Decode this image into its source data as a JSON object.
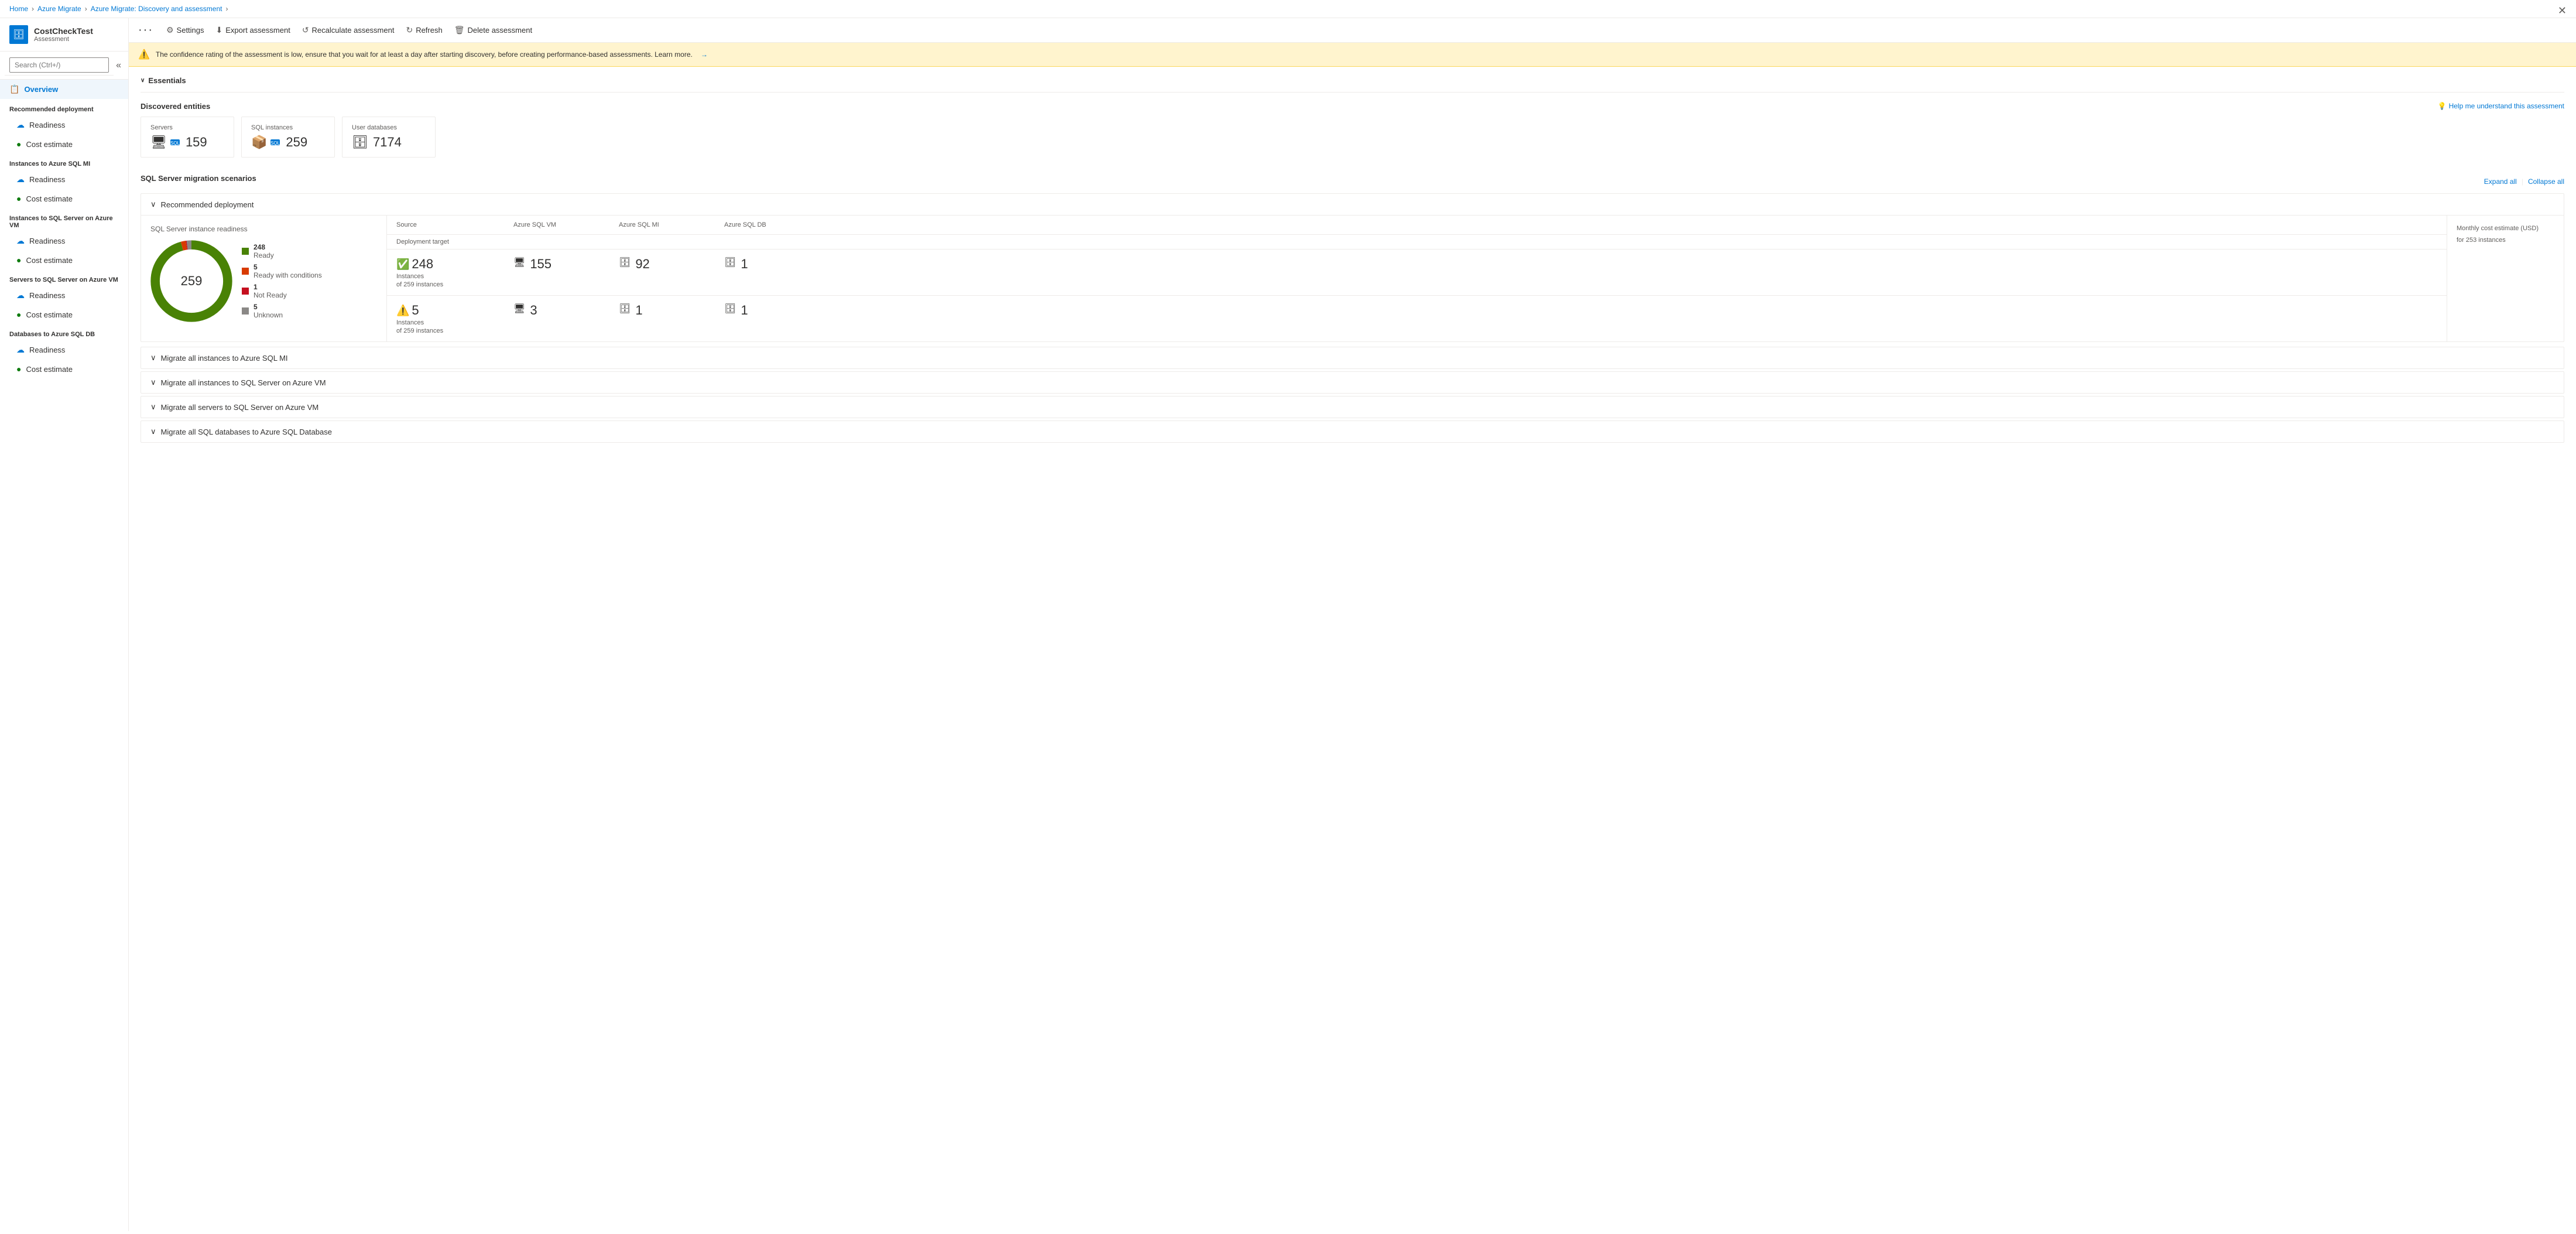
{
  "breadcrumb": {
    "items": [
      "Home",
      "Azure Migrate",
      "Azure Migrate: Discovery and assessment"
    ]
  },
  "sidebar": {
    "app_icon": "🗄",
    "app_title": "CostCheckTest",
    "app_subtitle": "Assessment",
    "search_placeholder": "Search (Ctrl+/)",
    "collapse_icon": "«",
    "nav": [
      {
        "id": "overview",
        "label": "Overview",
        "icon": "📋",
        "active": true
      },
      {
        "section": "Recommended deployment"
      },
      {
        "id": "rec-readiness",
        "label": "Readiness",
        "icon": "☁",
        "indent": true
      },
      {
        "id": "rec-cost",
        "label": "Cost estimate",
        "icon": "🟢",
        "indent": true
      },
      {
        "section": "Instances to Azure SQL MI"
      },
      {
        "id": "sqlmi-readiness",
        "label": "Readiness",
        "icon": "☁",
        "indent": true
      },
      {
        "id": "sqlmi-cost",
        "label": "Cost estimate",
        "icon": "🟢",
        "indent": true
      },
      {
        "section": "Instances to SQL Server on Azure VM"
      },
      {
        "id": "sqlvm-readiness",
        "label": "Readiness",
        "icon": "☁",
        "indent": true
      },
      {
        "id": "sqlvm-cost",
        "label": "Cost estimate",
        "icon": "🟢",
        "indent": true
      },
      {
        "section": "Servers to SQL Server on Azure VM"
      },
      {
        "id": "srvvm-readiness",
        "label": "Readiness",
        "icon": "☁",
        "indent": true
      },
      {
        "id": "srvvm-cost",
        "label": "Cost estimate",
        "icon": "🟢",
        "indent": true
      },
      {
        "section": "Databases to Azure SQL DB"
      },
      {
        "id": "sqldb-readiness",
        "label": "Readiness",
        "icon": "☁",
        "indent": true
      },
      {
        "id": "sqldb-cost",
        "label": "Cost estimate",
        "icon": "🟢",
        "indent": true
      }
    ]
  },
  "toolbar": {
    "dots": "...",
    "buttons": [
      {
        "id": "settings",
        "label": "Settings",
        "icon": "⚙"
      },
      {
        "id": "export",
        "label": "Export assessment",
        "icon": "⬇"
      },
      {
        "id": "recalculate",
        "label": "Recalculate assessment",
        "icon": "↺"
      },
      {
        "id": "refresh",
        "label": "Refresh",
        "icon": "↻"
      },
      {
        "id": "delete",
        "label": "Delete assessment",
        "icon": "🗑"
      }
    ]
  },
  "alert": {
    "icon": "⚠",
    "text": "The confidence rating of the assessment is low, ensure that you wait for at least a day after starting discovery, before creating performance-based assessments. Learn more.",
    "link_text": "→"
  },
  "essentials": {
    "label": "Essentials",
    "chevron": "∨"
  },
  "help_link": {
    "icon": "💡",
    "label": "Help me understand this assessment"
  },
  "discovered_entities": {
    "title": "Discovered entities",
    "cards": [
      {
        "label": "Servers",
        "value": "159",
        "icon": "🖥"
      },
      {
        "label": "SQL instances",
        "value": "259",
        "icon": "🗄"
      },
      {
        "label": "User databases",
        "value": "7174",
        "icon": "🗄"
      }
    ]
  },
  "migration_scenarios": {
    "title": "SQL Server migration scenarios",
    "expand_all": "Expand all",
    "collapse_all": "Collapse all",
    "recommended": {
      "label": "Recommended deployment",
      "chart": {
        "title": "SQL Server instance readiness",
        "total": "259",
        "legend": [
          {
            "color": "#498205",
            "label": "Ready",
            "value": "248"
          },
          {
            "color": "#d83b01",
            "label": "Ready with conditions",
            "value": "5"
          },
          {
            "color": "#c50f1f",
            "label": "Not Ready",
            "value": "1"
          },
          {
            "color": "#8a8886",
            "label": "Unknown",
            "value": "5"
          }
        ]
      },
      "data_header": {
        "source": "Source",
        "deployment_target": "Deployment target",
        "azure_sql_vm": "Azure SQL VM",
        "azure_sql_mi": "Azure SQL MI",
        "azure_sql_db": "Azure SQL DB"
      },
      "rows": [
        {
          "source_icon": "✅",
          "source_count": "248",
          "source_sub": "of 259 instances",
          "source_label": "Instances",
          "azure_sql_vm": "155",
          "azure_sql_mi": "92",
          "azure_sql_db": "1"
        },
        {
          "source_icon": "⚠",
          "source_count": "5",
          "source_sub": "of 259 instances",
          "source_label": "Instances",
          "azure_sql_vm": "3",
          "azure_sql_mi": "1",
          "azure_sql_db": "1"
        }
      ],
      "cost_panel": {
        "title": "Monthly cost estimate (USD)",
        "sub": "for 253 instances"
      }
    },
    "collapsed_scenarios": [
      {
        "id": "migrate-sql-mi",
        "label": "Migrate all instances to Azure SQL MI"
      },
      {
        "id": "migrate-sql-vm",
        "label": "Migrate all instances to SQL Server on Azure VM"
      },
      {
        "id": "migrate-servers-vm",
        "label": "Migrate all servers to SQL Server on Azure VM"
      },
      {
        "id": "migrate-sql-db",
        "label": "Migrate all SQL databases to Azure SQL Database"
      }
    ]
  },
  "close_btn": "✕"
}
